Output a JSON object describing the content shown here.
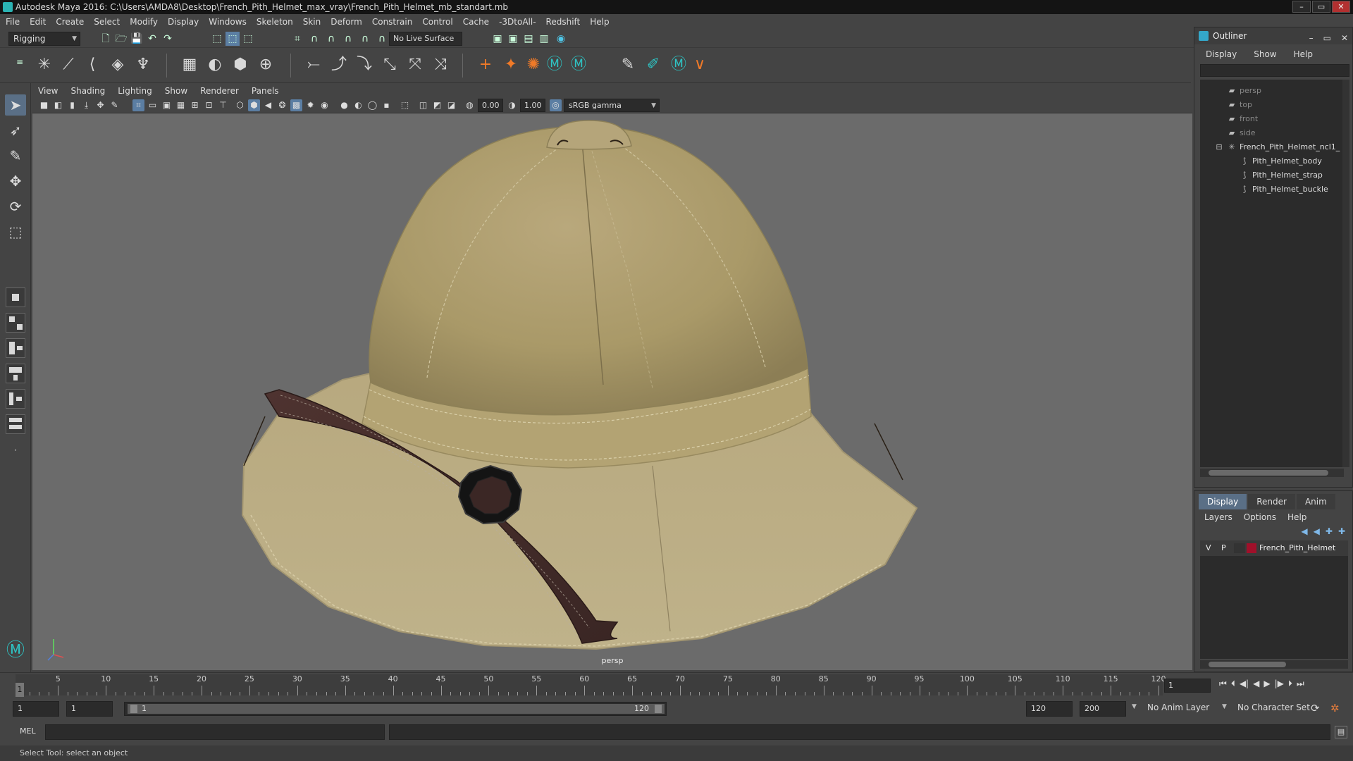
{
  "window": {
    "title": "Autodesk Maya 2016: C:\\Users\\AMDA8\\Desktop\\French_Pith_Helmet_max_vray\\French_Pith_Helmet_mb_standart.mb",
    "minimize": "–",
    "maximize": "▭",
    "close": "✕"
  },
  "menubar": [
    "File",
    "Edit",
    "Create",
    "Select",
    "Modify",
    "Display",
    "Windows",
    "Skeleton",
    "Skin",
    "Deform",
    "Constrain",
    "Control",
    "Cache",
    "-3DtoAll-",
    "Redshift",
    "Help"
  ],
  "statusline": {
    "mode": "Rigging",
    "live_surface": "No Live Surface"
  },
  "viewport": {
    "menu": [
      "View",
      "Shading",
      "Lighting",
      "Show",
      "Renderer",
      "Panels"
    ],
    "exposure": "0.00",
    "gamma": "1.00",
    "color_space": "sRGB gamma",
    "camera_label": "persp"
  },
  "outliner": {
    "title": "Outliner",
    "menu": [
      "Display",
      "Show",
      "Help"
    ],
    "items": [
      {
        "label": "persp",
        "type": "camera",
        "dim": true
      },
      {
        "label": "top",
        "type": "camera",
        "dim": true
      },
      {
        "label": "front",
        "type": "camera",
        "dim": true
      },
      {
        "label": "side",
        "type": "camera",
        "dim": true
      },
      {
        "label": "French_Pith_Helmet_ncl1_",
        "type": "group",
        "dim": false
      },
      {
        "label": "Pith_Helmet_body",
        "type": "mesh",
        "dim": false
      },
      {
        "label": "Pith_Helmet_strap",
        "type": "mesh",
        "dim": false
      },
      {
        "label": "Pith_Helmet_buckle",
        "type": "mesh",
        "dim": false
      }
    ]
  },
  "layer_editor": {
    "tabs": [
      "Display",
      "Render",
      "Anim"
    ],
    "active_tab": "Display",
    "menu": [
      "Layers",
      "Options",
      "Help"
    ],
    "layers": [
      {
        "visible": "V",
        "playback": "P",
        "name": "French_Pith_Helmet",
        "color": "#a0102a"
      }
    ]
  },
  "timeslider": {
    "ticks": [
      1,
      5,
      10,
      15,
      20,
      25,
      30,
      35,
      40,
      45,
      50,
      55,
      60,
      65,
      70,
      75,
      80,
      85,
      90,
      95,
      100,
      105,
      110,
      115,
      120
    ],
    "labeled": [
      5,
      10,
      15,
      20,
      25,
      30,
      35,
      40,
      45,
      50,
      55,
      60,
      65,
      70,
      75,
      80,
      85,
      90,
      95,
      100,
      105,
      110,
      115,
      120
    ],
    "current_frame": "1",
    "current_frame_field": "1"
  },
  "rangeslider": {
    "start": "1",
    "playback_start": "1",
    "range_start_label": "1",
    "range_end_label": "120",
    "playback_end": "120",
    "end": "200",
    "anim_layer": "No Anim Layer",
    "character_set": "No Character Set"
  },
  "cmdline": {
    "lang": "MEL"
  },
  "helpline": {
    "text": "Select Tool: select an object"
  }
}
